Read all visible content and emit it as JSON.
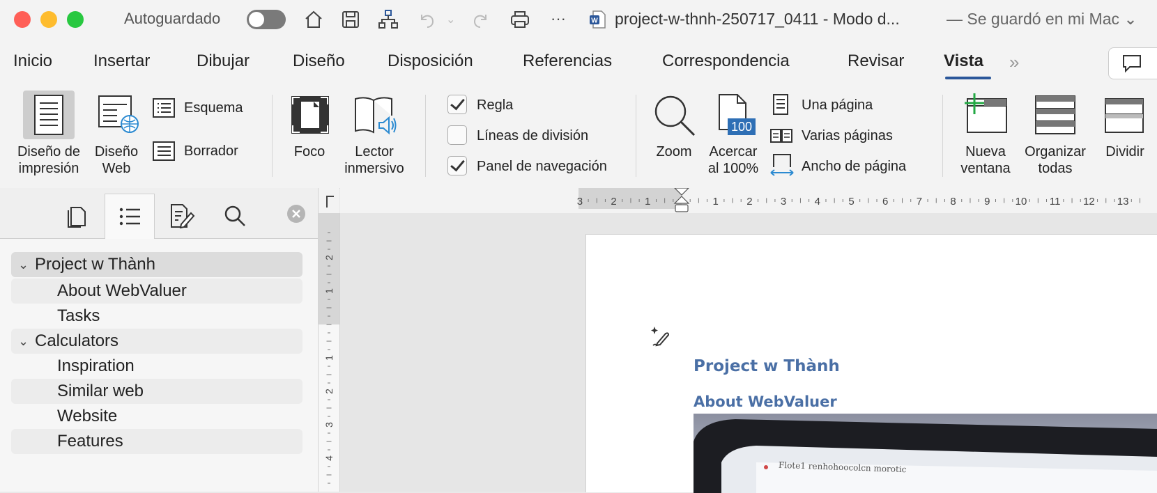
{
  "titlebar": {
    "autosave_label": "Autoguardado",
    "document_title": "project-w-thnh-250717_0411  -  Modo d...",
    "save_status": "— Se guardó en mi Mac ⌄",
    "more_label": "···"
  },
  "tabs": [
    {
      "label": "Inicio"
    },
    {
      "label": "Insertar"
    },
    {
      "label": "Dibujar"
    },
    {
      "label": "Diseño"
    },
    {
      "label": "Disposición"
    },
    {
      "label": "Referencias"
    },
    {
      "label": "Correspondencia"
    },
    {
      "label": "Revisar"
    },
    {
      "label": "Vista"
    }
  ],
  "tabs_overflow": "»",
  "ribbon": {
    "print_layout": "Diseño de\nimpresión",
    "web_layout": "Diseño\nWeb",
    "outline": "Esquema",
    "draft": "Borrador",
    "focus": "Foco",
    "immersive_reader": "Lector\ninmersivo",
    "ruler": "Regla",
    "gridlines": "Líneas de división",
    "nav_pane": "Panel de navegación",
    "zoom": "Zoom",
    "zoom_100": "Acercar\nal 100%",
    "zoom_badge": "100",
    "one_page": "Una página",
    "multiple_pages": "Varias páginas",
    "page_width": "Ancho de página",
    "new_window": "Nueva\nventana",
    "arrange_all": "Organizar\ntodas",
    "split": "Dividir"
  },
  "checkboxes": {
    "ruler": true,
    "gridlines": false,
    "nav_pane": true
  },
  "navigation": {
    "items": [
      {
        "label": "Project w Thành",
        "level": 1,
        "expanded": true
      },
      {
        "label": "About WebValuer",
        "level": 2
      },
      {
        "label": "Tasks",
        "level": 2
      },
      {
        "label": "Calculators",
        "level": 1,
        "expanded": true
      },
      {
        "label": "Inspiration",
        "level": 2
      },
      {
        "label": "Similar web",
        "level": 2
      },
      {
        "label": "Website",
        "level": 2
      },
      {
        "label": "Features",
        "level": 2
      }
    ]
  },
  "ruler": {
    "h_labels": [
      "3",
      "2",
      "1",
      "1",
      "2",
      "3",
      "4",
      "5",
      "6",
      "7",
      "8",
      "9",
      "10",
      "11",
      "12",
      "13"
    ],
    "v_labels": [
      "2",
      "1",
      "1",
      "2",
      "3",
      "4"
    ]
  },
  "document": {
    "heading1": "Project w Thành",
    "heading2": "About WebValuer",
    "image_caption": "Flote1 renhohoocolcn morotic"
  },
  "colors": {
    "accent": "#2b579a",
    "heading": "#4a6fa5"
  }
}
